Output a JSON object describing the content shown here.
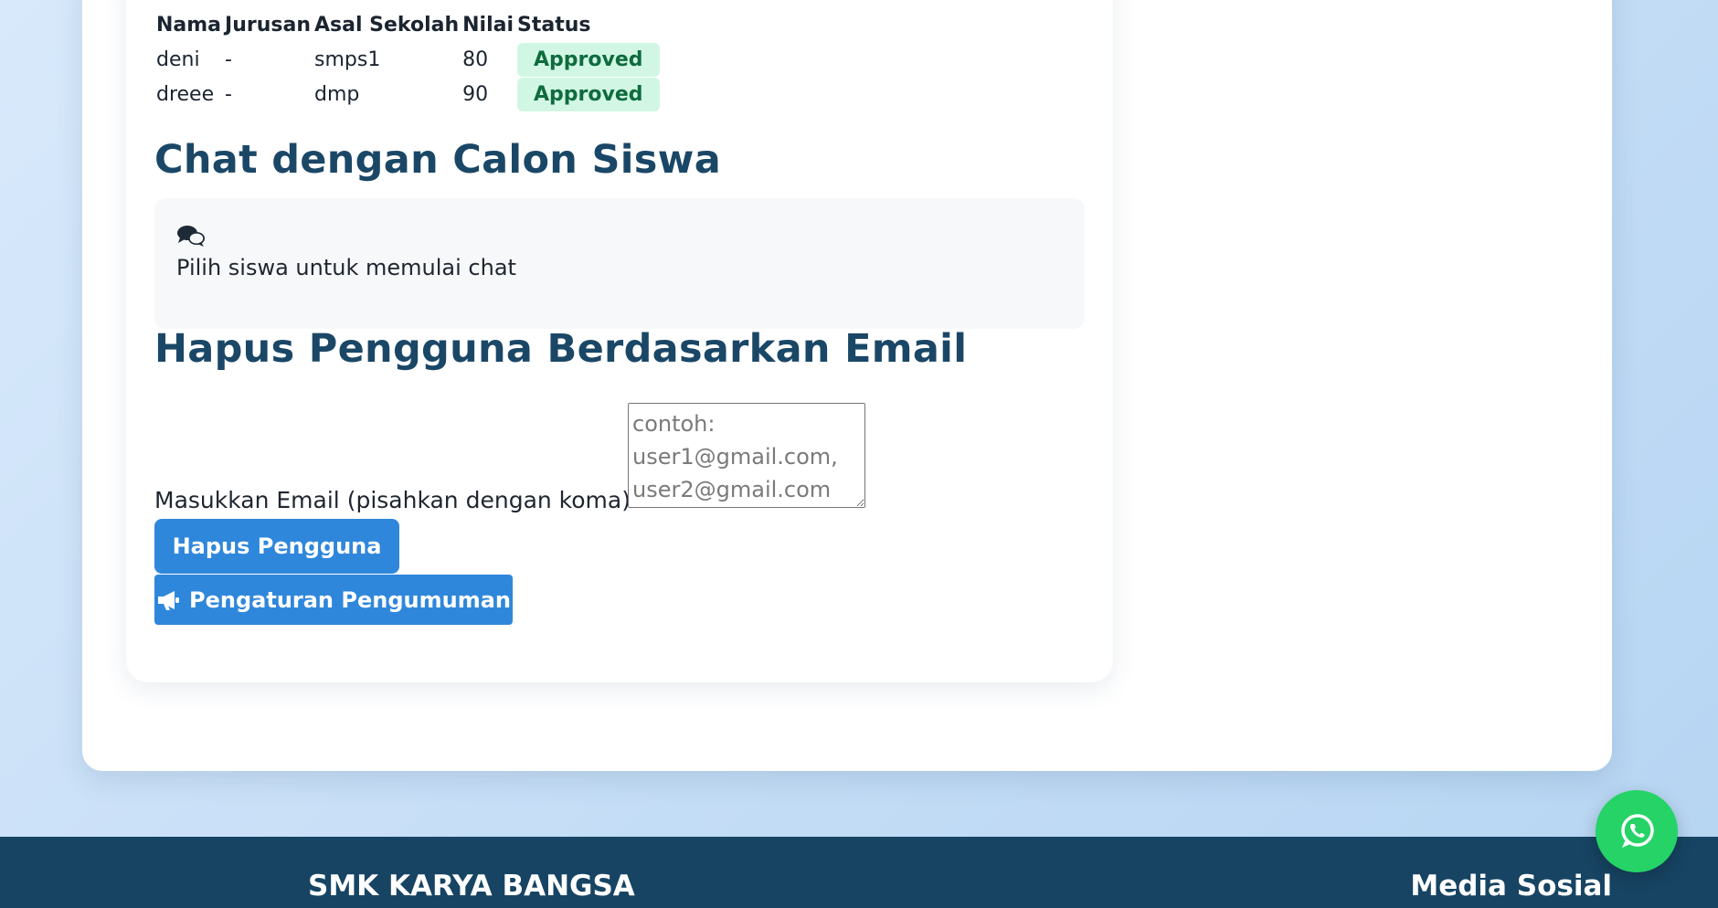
{
  "table": {
    "headers": [
      "Nama",
      "Jurusan",
      "Asal Sekolah",
      "Nilai",
      "Status"
    ],
    "rows": [
      {
        "nama": "deni",
        "jurusan": "-",
        "asal_sekolah": "smps1",
        "nilai": "80",
        "status": "Approved"
      },
      {
        "nama": "dreee",
        "jurusan": "-",
        "asal_sekolah": "dmp",
        "nilai": "90",
        "status": "Approved"
      }
    ]
  },
  "chat": {
    "title": "Chat dengan Calon Siswa",
    "icon": "comments-icon",
    "empty_text": "Pilih siswa untuk memulai chat"
  },
  "delete_users": {
    "title": "Hapus Pengguna Berdasarkan Email",
    "label": "Masukkan Email (pisahkan dengan koma):",
    "placeholder": "contoh: user1@gmail.com, user2@gmail.com",
    "value": "",
    "button_label": "Hapus Pengguna"
  },
  "announcement_button": {
    "icon": "megaphone-icon",
    "label": "Pengaturan Pengumuman"
  },
  "footer": {
    "brand": "SMK KARYA BANGSA",
    "social_heading": "Media Sosial"
  },
  "whatsapp": {
    "icon": "whatsapp-icon"
  },
  "colors": {
    "primary_button": "#2f87db",
    "heading": "#1b4767",
    "footer_bg": "#174463",
    "approved_bg": "#d1f7e4",
    "approved_text": "#0f6b3d",
    "whatsapp": "#25d366"
  }
}
